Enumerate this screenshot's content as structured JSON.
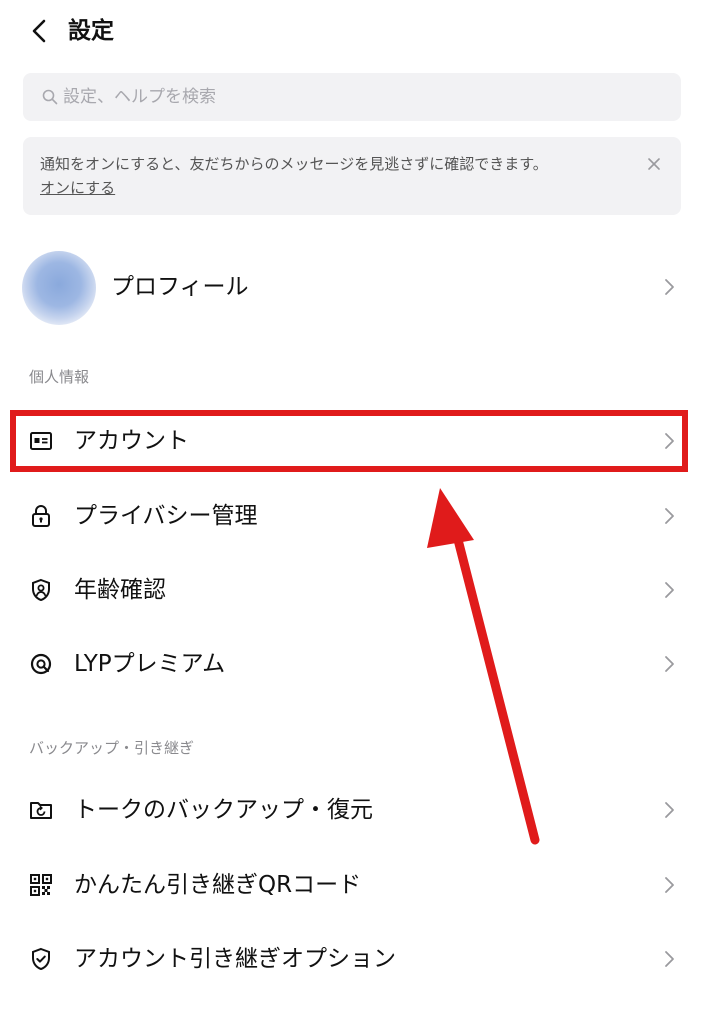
{
  "header": {
    "title": "設定",
    "back_icon": "chevron-left-icon"
  },
  "search": {
    "placeholder": "設定、ヘルプを検索",
    "value": ""
  },
  "notice": {
    "text": "通知をオンにすると、友だちからのメッセージを見逃さずに確認できます。",
    "link": "オンにする"
  },
  "profile": {
    "label": "プロフィール"
  },
  "sections": {
    "personal": {
      "title": "個人情報",
      "items": [
        {
          "label": "アカウント",
          "icon": "id-card-icon"
        },
        {
          "label": "プライバシー管理",
          "icon": "lock-icon"
        },
        {
          "label": "年齢確認",
          "icon": "age-verification-icon"
        },
        {
          "label": "LYPプレミアム",
          "icon": "premium-icon"
        }
      ]
    },
    "backup": {
      "title": "バックアップ・引き継ぎ",
      "items": [
        {
          "label": "トークのバックアップ・復元",
          "icon": "backup-folder-icon"
        },
        {
          "label": "かんたん引き継ぎQRコード",
          "icon": "qr-code-icon"
        },
        {
          "label": "アカウント引き継ぎオプション",
          "icon": "shield-check-icon"
        }
      ]
    }
  },
  "colors": {
    "highlight": "#e01b1b",
    "field_background": "#f2f2f4"
  }
}
